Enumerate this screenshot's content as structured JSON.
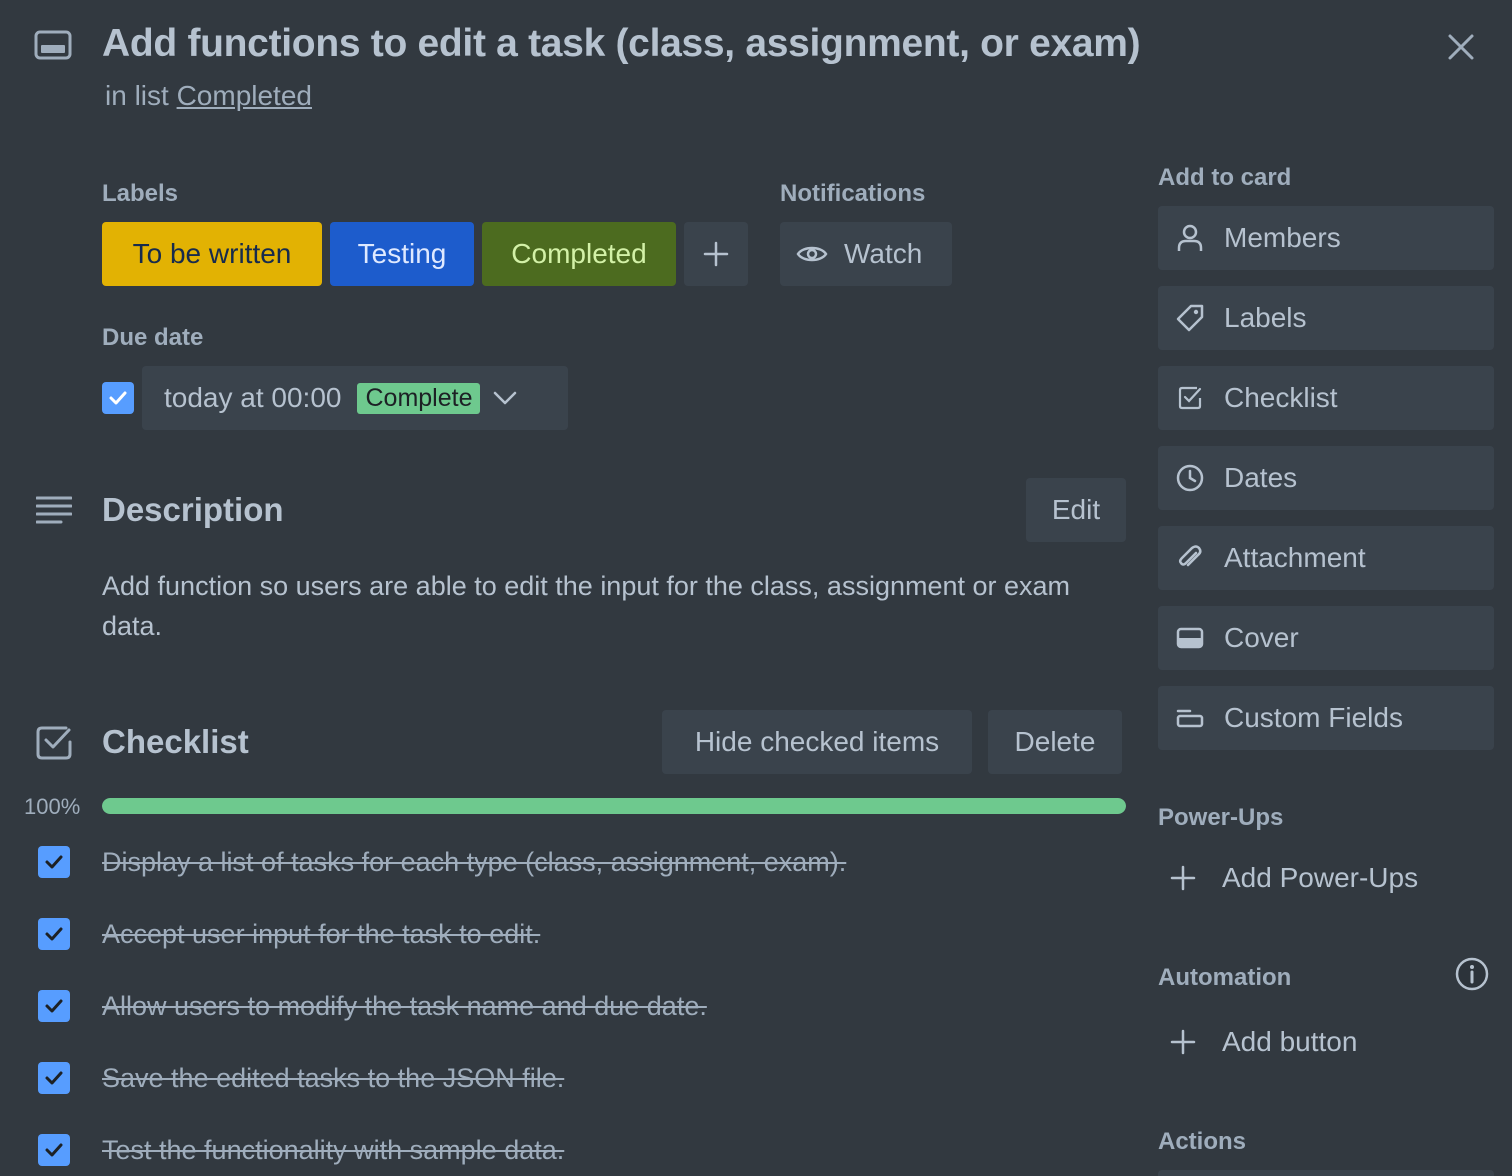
{
  "card": {
    "title": "Add functions to edit a task (class, assignment, or exam)",
    "in_list_prefix": "in list",
    "list_name": "Completed"
  },
  "labels": {
    "heading": "Labels",
    "items": [
      {
        "text": "To be written",
        "bg": "#e2b203",
        "fg": "#172b4d"
      },
      {
        "text": "Testing",
        "bg": "#1d5ccc",
        "fg": "#dfe9ff"
      },
      {
        "text": "Completed",
        "bg": "#4c6b1f",
        "fg": "#d3f1a7"
      }
    ],
    "add_icon": "plus-icon"
  },
  "notifications": {
    "heading": "Notifications",
    "watch_label": "Watch",
    "watch_icon": "eye-icon"
  },
  "due_date": {
    "heading": "Due date",
    "value": "today at 00:00",
    "badge": "Complete",
    "badge_color": "#6ec98e",
    "checked": true
  },
  "description": {
    "heading": "Description",
    "edit_label": "Edit",
    "text": "Add function so users are able to edit the input for the class, assignment or exam data."
  },
  "checklist": {
    "heading": "Checklist",
    "hide_label": "Hide checked items",
    "delete_label": "Delete",
    "progress_text": "100%",
    "progress": 1.0,
    "items": [
      {
        "text": "Display a list of tasks for each type (class, assignment, exam).",
        "checked": true
      },
      {
        "text": "Accept user input for the task to edit.",
        "checked": true
      },
      {
        "text": "Allow users to modify the task name and due date.",
        "checked": true
      },
      {
        "text": "Save the edited tasks to the JSON file.",
        "checked": true
      },
      {
        "text": "Test the functionality with sample data.",
        "checked": true
      }
    ]
  },
  "sidebar": {
    "add_to_card_heading": "Add to card",
    "buttons": [
      {
        "label": "Members",
        "icon": "person-icon"
      },
      {
        "label": "Labels",
        "icon": "tag-icon"
      },
      {
        "label": "Checklist",
        "icon": "checklist-icon"
      },
      {
        "label": "Dates",
        "icon": "clock-icon"
      },
      {
        "label": "Attachment",
        "icon": "paperclip-icon"
      },
      {
        "label": "Cover",
        "icon": "cover-icon"
      },
      {
        "label": "Custom Fields",
        "icon": "custom-fields-icon"
      }
    ],
    "powerups_heading": "Power-Ups",
    "add_powerups_label": "Add Power-Ups",
    "automation_heading": "Automation",
    "add_button_label": "Add button",
    "actions_heading": "Actions"
  },
  "colors": {
    "background": "#323940",
    "button_bg": "#3a434c",
    "text": "#b6c2cf",
    "subtle_text": "#9fadbc",
    "checkbox": "#579dff",
    "progress": "#6ec98e"
  }
}
